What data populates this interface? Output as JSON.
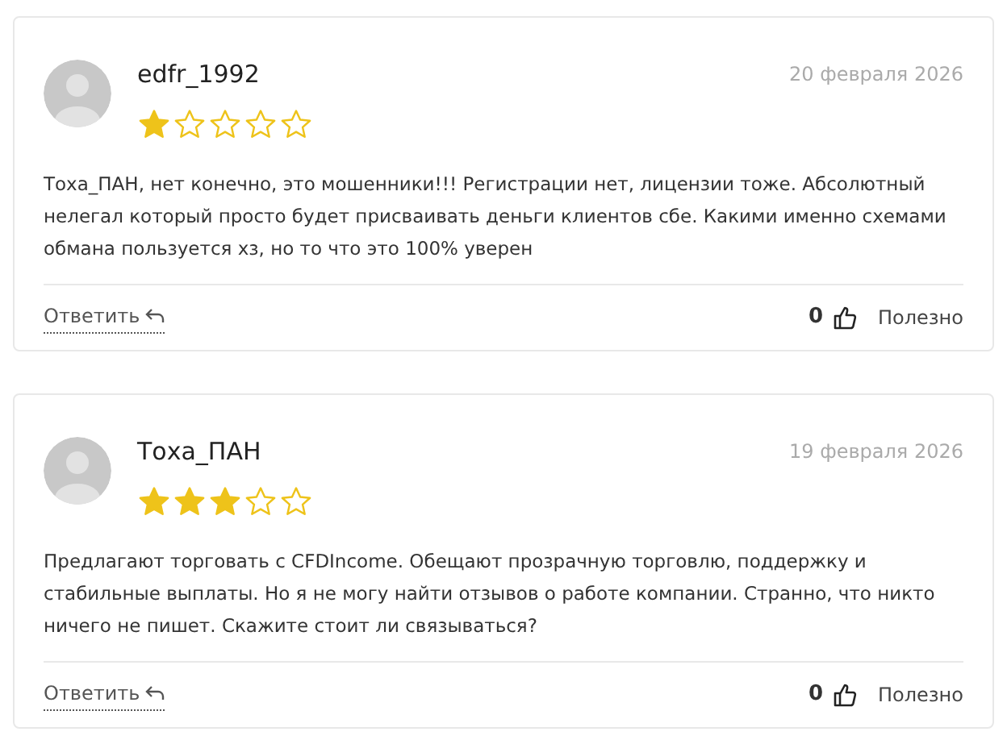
{
  "reviews": [
    {
      "author": "edfr_1992",
      "date": "20 февраля 2026",
      "stars": 1,
      "text": "Тоха_ПАН, нет конечно, это мошенники!!! Регистрации нет, лицензии тоже. Абсолютный нелегал который просто будет присваивать деньги клиентов сбе. Какими именно схемами обмана пользуется хз, но то что это 100% уверен",
      "reply": "Ответить",
      "likes": "0",
      "useful": "Полезно"
    },
    {
      "author": "Тоха_ПАН",
      "date": "19 февраля 2026",
      "stars": 3,
      "text": "Предлагают торговать с CFDIncome. Обещают прозрачную торговлю, поддержку и стабильные выплаты. Но я не могу найти отзывов о работе компании. Странно, что никто ничего не пишет. Скажите стоит ли связываться?",
      "reply": "Ответить",
      "likes": "0",
      "useful": "Полезно"
    }
  ]
}
